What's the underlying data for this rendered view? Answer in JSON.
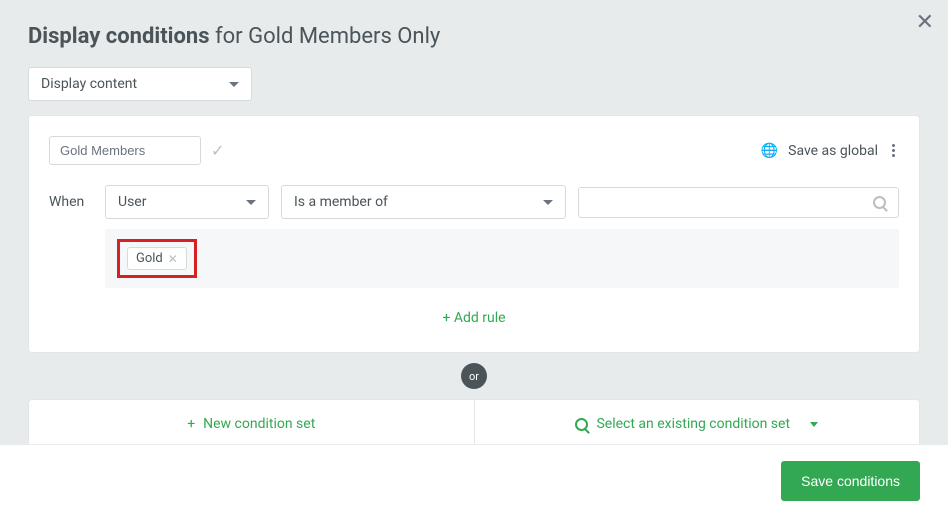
{
  "header": {
    "title_bold": "Display conditions",
    "title_rest": " for Gold Members Only"
  },
  "content_mode": "Display content",
  "set": {
    "name": "Gold Members",
    "save_global": "Save as global",
    "when_label": "When",
    "subject": "User",
    "relation": "Is a member of",
    "tag": "Gold",
    "add_rule": "+ Add rule"
  },
  "or_label": "or",
  "bottom": {
    "new_set": "New condition set",
    "select_existing": "Select an existing condition set"
  },
  "footer": {
    "save": "Save conditions"
  }
}
